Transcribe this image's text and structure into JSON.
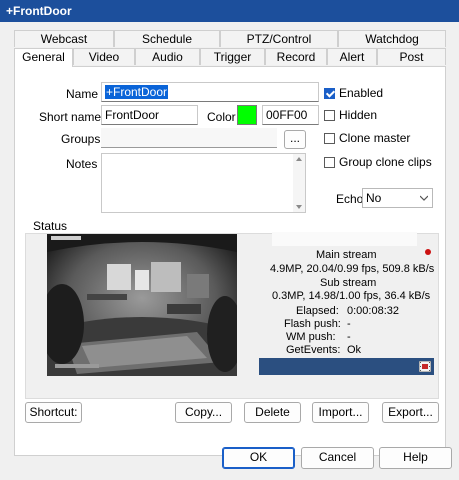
{
  "window": {
    "title": "+FrontDoor"
  },
  "tabs": {
    "row1": [
      "Webcast",
      "Schedule",
      "PTZ/Control",
      "Watchdog"
    ],
    "row2": [
      "General",
      "Video",
      "Audio",
      "Trigger",
      "Record",
      "Alert",
      "Post"
    ],
    "active": "General"
  },
  "form": {
    "name_label": "Name",
    "name_value": "+FrontDoor",
    "short_name_label": "Short name",
    "short_name_value": "FrontDoor",
    "color_label": "Color",
    "color_swatch": "#00ff00",
    "color_value": "00FF00",
    "groups_label": "Groups",
    "groups_value": "",
    "groups_button": "...",
    "notes_label": "Notes",
    "notes_value": "",
    "echo_label": "Echo",
    "echo_value": "No"
  },
  "checks": {
    "enabled": {
      "label": "Enabled",
      "checked": true
    },
    "hidden": {
      "label": "Hidden",
      "checked": false
    },
    "clone_master": {
      "label": "Clone master",
      "checked": false
    },
    "group_clone_clips": {
      "label": "Group clone clips",
      "checked": false
    }
  },
  "status": {
    "title": "Status",
    "main_stream_label": "Main stream",
    "main_stream_stats": "4.9MP, 20.04/0.99 fps,  509.8 kB/s",
    "sub_stream_label": "Sub stream",
    "sub_stream_stats": "0.3MP, 14.98/1.00 fps,   36.4 kB/s",
    "elapsed_label": "Elapsed:",
    "elapsed_value": "0:00:08:32",
    "flash_push_label": "Flash push:",
    "flash_push_value": "-",
    "wm_push_label": "WM push:",
    "wm_push_value": "-",
    "get_events_label": "GetEvents:",
    "get_events_value": "Ok",
    "recording_dot_color": "#cc1111",
    "bar_color": "#2b4f80"
  },
  "panel_buttons": {
    "shortcut": "Shortcut:",
    "copy": "Copy...",
    "delete": "Delete",
    "import": "Import...",
    "export": "Export..."
  },
  "dialog_buttons": {
    "ok": "OK",
    "cancel": "Cancel",
    "help": "Help"
  }
}
